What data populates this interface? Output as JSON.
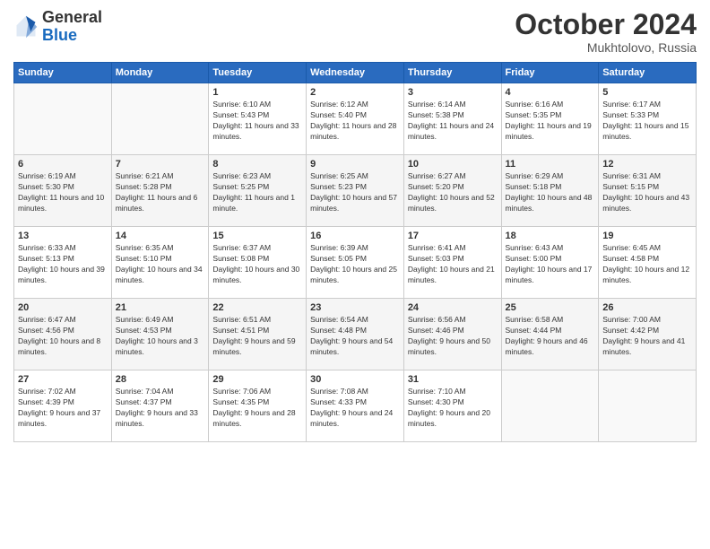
{
  "header": {
    "logo_general": "General",
    "logo_blue": "Blue",
    "month": "October 2024",
    "location": "Mukhtolovo, Russia"
  },
  "days_of_week": [
    "Sunday",
    "Monday",
    "Tuesday",
    "Wednesday",
    "Thursday",
    "Friday",
    "Saturday"
  ],
  "weeks": [
    {
      "days": [
        {
          "num": "",
          "sunrise": "",
          "sunset": "",
          "daylight": ""
        },
        {
          "num": "",
          "sunrise": "",
          "sunset": "",
          "daylight": ""
        },
        {
          "num": "1",
          "sunrise": "Sunrise: 6:10 AM",
          "sunset": "Sunset: 5:43 PM",
          "daylight": "Daylight: 11 hours and 33 minutes."
        },
        {
          "num": "2",
          "sunrise": "Sunrise: 6:12 AM",
          "sunset": "Sunset: 5:40 PM",
          "daylight": "Daylight: 11 hours and 28 minutes."
        },
        {
          "num": "3",
          "sunrise": "Sunrise: 6:14 AM",
          "sunset": "Sunset: 5:38 PM",
          "daylight": "Daylight: 11 hours and 24 minutes."
        },
        {
          "num": "4",
          "sunrise": "Sunrise: 6:16 AM",
          "sunset": "Sunset: 5:35 PM",
          "daylight": "Daylight: 11 hours and 19 minutes."
        },
        {
          "num": "5",
          "sunrise": "Sunrise: 6:17 AM",
          "sunset": "Sunset: 5:33 PM",
          "daylight": "Daylight: 11 hours and 15 minutes."
        }
      ]
    },
    {
      "days": [
        {
          "num": "6",
          "sunrise": "Sunrise: 6:19 AM",
          "sunset": "Sunset: 5:30 PM",
          "daylight": "Daylight: 11 hours and 10 minutes."
        },
        {
          "num": "7",
          "sunrise": "Sunrise: 6:21 AM",
          "sunset": "Sunset: 5:28 PM",
          "daylight": "Daylight: 11 hours and 6 minutes."
        },
        {
          "num": "8",
          "sunrise": "Sunrise: 6:23 AM",
          "sunset": "Sunset: 5:25 PM",
          "daylight": "Daylight: 11 hours and 1 minute."
        },
        {
          "num": "9",
          "sunrise": "Sunrise: 6:25 AM",
          "sunset": "Sunset: 5:23 PM",
          "daylight": "Daylight: 10 hours and 57 minutes."
        },
        {
          "num": "10",
          "sunrise": "Sunrise: 6:27 AM",
          "sunset": "Sunset: 5:20 PM",
          "daylight": "Daylight: 10 hours and 52 minutes."
        },
        {
          "num": "11",
          "sunrise": "Sunrise: 6:29 AM",
          "sunset": "Sunset: 5:18 PM",
          "daylight": "Daylight: 10 hours and 48 minutes."
        },
        {
          "num": "12",
          "sunrise": "Sunrise: 6:31 AM",
          "sunset": "Sunset: 5:15 PM",
          "daylight": "Daylight: 10 hours and 43 minutes."
        }
      ]
    },
    {
      "days": [
        {
          "num": "13",
          "sunrise": "Sunrise: 6:33 AM",
          "sunset": "Sunset: 5:13 PM",
          "daylight": "Daylight: 10 hours and 39 minutes."
        },
        {
          "num": "14",
          "sunrise": "Sunrise: 6:35 AM",
          "sunset": "Sunset: 5:10 PM",
          "daylight": "Daylight: 10 hours and 34 minutes."
        },
        {
          "num": "15",
          "sunrise": "Sunrise: 6:37 AM",
          "sunset": "Sunset: 5:08 PM",
          "daylight": "Daylight: 10 hours and 30 minutes."
        },
        {
          "num": "16",
          "sunrise": "Sunrise: 6:39 AM",
          "sunset": "Sunset: 5:05 PM",
          "daylight": "Daylight: 10 hours and 25 minutes."
        },
        {
          "num": "17",
          "sunrise": "Sunrise: 6:41 AM",
          "sunset": "Sunset: 5:03 PM",
          "daylight": "Daylight: 10 hours and 21 minutes."
        },
        {
          "num": "18",
          "sunrise": "Sunrise: 6:43 AM",
          "sunset": "Sunset: 5:00 PM",
          "daylight": "Daylight: 10 hours and 17 minutes."
        },
        {
          "num": "19",
          "sunrise": "Sunrise: 6:45 AM",
          "sunset": "Sunset: 4:58 PM",
          "daylight": "Daylight: 10 hours and 12 minutes."
        }
      ]
    },
    {
      "days": [
        {
          "num": "20",
          "sunrise": "Sunrise: 6:47 AM",
          "sunset": "Sunset: 4:56 PM",
          "daylight": "Daylight: 10 hours and 8 minutes."
        },
        {
          "num": "21",
          "sunrise": "Sunrise: 6:49 AM",
          "sunset": "Sunset: 4:53 PM",
          "daylight": "Daylight: 10 hours and 3 minutes."
        },
        {
          "num": "22",
          "sunrise": "Sunrise: 6:51 AM",
          "sunset": "Sunset: 4:51 PM",
          "daylight": "Daylight: 9 hours and 59 minutes."
        },
        {
          "num": "23",
          "sunrise": "Sunrise: 6:54 AM",
          "sunset": "Sunset: 4:48 PM",
          "daylight": "Daylight: 9 hours and 54 minutes."
        },
        {
          "num": "24",
          "sunrise": "Sunrise: 6:56 AM",
          "sunset": "Sunset: 4:46 PM",
          "daylight": "Daylight: 9 hours and 50 minutes."
        },
        {
          "num": "25",
          "sunrise": "Sunrise: 6:58 AM",
          "sunset": "Sunset: 4:44 PM",
          "daylight": "Daylight: 9 hours and 46 minutes."
        },
        {
          "num": "26",
          "sunrise": "Sunrise: 7:00 AM",
          "sunset": "Sunset: 4:42 PM",
          "daylight": "Daylight: 9 hours and 41 minutes."
        }
      ]
    },
    {
      "days": [
        {
          "num": "27",
          "sunrise": "Sunrise: 7:02 AM",
          "sunset": "Sunset: 4:39 PM",
          "daylight": "Daylight: 9 hours and 37 minutes."
        },
        {
          "num": "28",
          "sunrise": "Sunrise: 7:04 AM",
          "sunset": "Sunset: 4:37 PM",
          "daylight": "Daylight: 9 hours and 33 minutes."
        },
        {
          "num": "29",
          "sunrise": "Sunrise: 7:06 AM",
          "sunset": "Sunset: 4:35 PM",
          "daylight": "Daylight: 9 hours and 28 minutes."
        },
        {
          "num": "30",
          "sunrise": "Sunrise: 7:08 AM",
          "sunset": "Sunset: 4:33 PM",
          "daylight": "Daylight: 9 hours and 24 minutes."
        },
        {
          "num": "31",
          "sunrise": "Sunrise: 7:10 AM",
          "sunset": "Sunset: 4:30 PM",
          "daylight": "Daylight: 9 hours and 20 minutes."
        },
        {
          "num": "",
          "sunrise": "",
          "sunset": "",
          "daylight": ""
        },
        {
          "num": "",
          "sunrise": "",
          "sunset": "",
          "daylight": ""
        }
      ]
    }
  ]
}
